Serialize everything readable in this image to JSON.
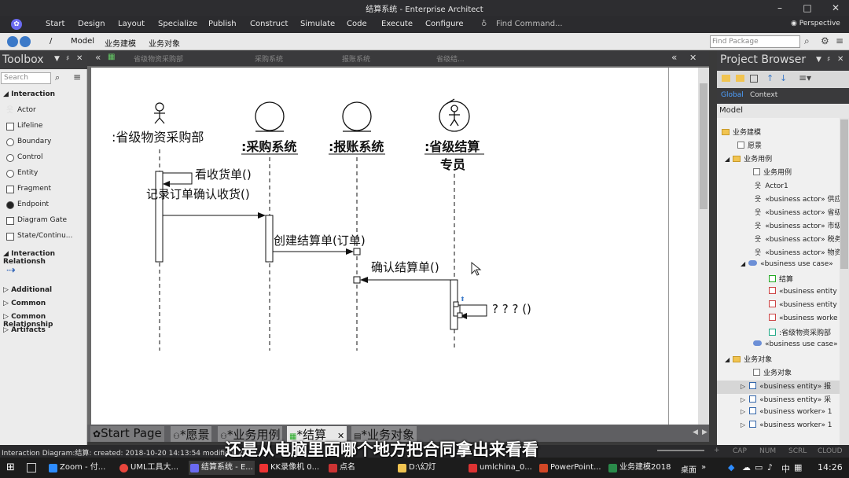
{
  "window": {
    "title": "结算系统 - Enterprise Architect"
  },
  "menu": [
    "Start",
    "Design",
    "Layout",
    "Specialize",
    "Publish",
    "Construct",
    "Simulate",
    "Code",
    "Execute",
    "Configure"
  ],
  "find_command": "Find Command...",
  "perspective": "Perspective",
  "nav": {
    "path": [
      "/",
      "Model",
      "业务建模",
      "业务对象"
    ],
    "find_package": "Find Package"
  },
  "toolbox": {
    "title": "Toolbox",
    "search": "Search",
    "section_interaction": "Interaction",
    "items": [
      "Actor",
      "Lifeline",
      "Boundary",
      "Control",
      "Entity",
      "Fragment",
      "Endpoint",
      "Diagram Gate",
      "State/Continu..."
    ],
    "section_relationships": "Interaction Relationsh",
    "collapsed_sections": [
      "Additional",
      "Common",
      "Common Relationship",
      "Artifacts"
    ]
  },
  "diagram": {
    "top_tabs": [
      "省级物资采购部",
      "采购系统",
      "报账系统",
      "省级结..."
    ],
    "lifelines": [
      {
        "name": ":省级物资采购部",
        "kind": "actor"
      },
      {
        "name": ":采购系统",
        "kind": "entity"
      },
      {
        "name": ":报账系统",
        "kind": "entity"
      },
      {
        "name": ":省级结算",
        "name2": "专员",
        "kind": "worker"
      }
    ],
    "messages": [
      "看收货单()",
      "记录订单确认收货()",
      "创建结算单(订单)",
      "确认结算单()",
      "? ? ? ()"
    ]
  },
  "bottom_tabs": [
    "Start Page",
    "*愿景",
    "*业务用例",
    "*结算",
    "*业务对象"
  ],
  "project_browser": {
    "title": "Project Browser",
    "tabs": [
      "Global",
      "Context"
    ],
    "model_label": "Model",
    "rows": [
      "业务建模",
      "愿景",
      "业务用例",
      "业务用例",
      "Actor1",
      "«business actor» 供应",
      "«business actor» 省级",
      "«business actor» 市级",
      "«business actor» 税务",
      "«business actor» 物资",
      "«business use case» ",
      "结算",
      "«business entity",
      "«business entity",
      "«business worke",
      ":省级物资采购部",
      "«business use case» ",
      "业务对象",
      "业务对象",
      "«business entity» 报",
      "«business entity» 采",
      "«business worker» 1",
      "«business worker» 1"
    ]
  },
  "status": {
    "left": "Interaction Diagram:结算:   created: 2018-10-20 14:13:54  modified: 20",
    "indicators": [
      "CAP",
      "NUM",
      "SCRL",
      "CLOUD"
    ]
  },
  "subtitle": "还是从电脑里面哪个地方把合同拿出来看看",
  "taskbar": {
    "items": [
      "Zoom - 付...",
      "UML工具大...",
      "结算系统 - E...",
      "KK录像机 0...",
      "点名",
      "D:\\幻灯",
      "umlchina_0...",
      "PowerPoint...",
      "业务建模2018"
    ],
    "tray_left": "桌面",
    "ime": "中",
    "clock": "14:26"
  },
  "colors": {
    "accent": "#3b79c8",
    "canvas": "#ffffff",
    "chrome_dark": "#2d2d30"
  }
}
